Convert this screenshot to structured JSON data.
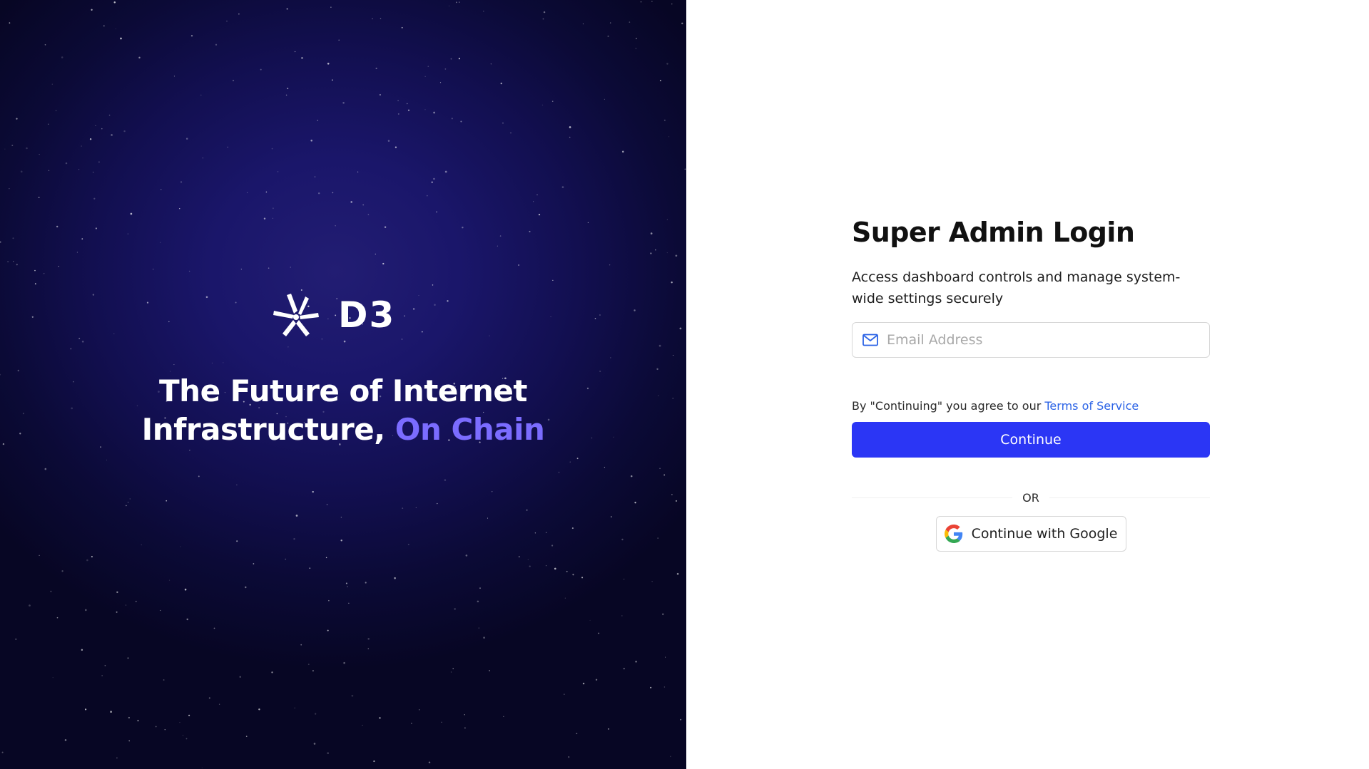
{
  "hero": {
    "brand_name": "D3",
    "tagline_line1": "The Future of Internet",
    "tagline_line2": "Infrastructure,",
    "tagline_accent": "On Chain",
    "logo_icon": "d3-logo-icon",
    "accent_color": "#7b6cff"
  },
  "login": {
    "title": "Super Admin Login",
    "subtitle": "Access dashboard controls and manage system-wide settings securely",
    "email_placeholder": "Email Address",
    "email_icon": "mail-icon",
    "terms_prefix": "By \"Continuing\" you agree to our",
    "terms_link": "Terms of Service",
    "continue_label": "Continue",
    "or_label": "OR",
    "google_label": "Continue with Google",
    "google_icon": "google-icon",
    "primary_color": "#2b36f5",
    "link_color": "#2b63e6"
  }
}
